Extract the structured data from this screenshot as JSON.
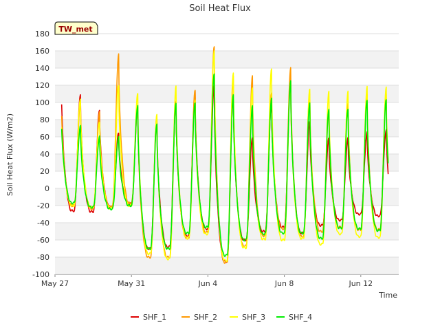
{
  "chart_data": {
    "type": "line",
    "title": "Soil Heat Flux",
    "xlabel": "Time",
    "ylabel": "Soil Heat Flux (W/m2)",
    "badge": "TW_met",
    "ylim": [
      -100,
      180
    ],
    "yticks": [
      -100,
      -80,
      -60,
      -40,
      -20,
      0,
      20,
      40,
      60,
      80,
      100,
      120,
      140,
      160,
      180
    ],
    "xlim": [
      "2024-05-27",
      "2024-06-15"
    ],
    "xticks": [
      {
        "label": "May 27",
        "day": 0
      },
      {
        "label": "May 31",
        "day": 4
      },
      {
        "label": "Jun 4",
        "day": 8
      },
      {
        "label": "Jun 8",
        "day": 12
      },
      {
        "label": "Jun 12",
        "day": 16
      }
    ],
    "grid": "horizontal bands",
    "legend": "bottom",
    "series": [
      {
        "name": "SHF_1",
        "color": "#dd0000",
        "min": [
          -26,
          -26,
          -27,
          -22,
          -18,
          -70,
          -68,
          -55,
          -47,
          -85,
          -60,
          -50,
          -45,
          -52,
          -43,
          -37,
          -30,
          -32,
          -30,
          -42
        ],
        "max": [
          130,
          110,
          92,
          65,
          95,
          80,
          100,
          112,
          120,
          110,
          60,
          100,
          125,
          78,
          58,
          58,
          65,
          68
        ]
      },
      {
        "name": "SHF_2",
        "color": "#ff9900",
        "min": [
          -22,
          -20,
          -24,
          -21,
          -17,
          -80,
          -80,
          -57,
          -51,
          -86,
          -67,
          -55,
          -47,
          -56,
          -50,
          -45,
          -48,
          -48,
          -45,
          -45
        ],
        "max": [
          112,
          100,
          88,
          156,
          95,
          85,
          100,
          115,
          165,
          130,
          130,
          110,
          140,
          110,
          90,
          100,
          110,
          110
        ]
      },
      {
        "name": "SHF_3",
        "color": "#ffff00",
        "min": [
          -20,
          -20,
          -22,
          -23,
          -20,
          -76,
          -82,
          -58,
          -53,
          -84,
          -69,
          -59,
          -60,
          -58,
          -65,
          -53,
          -56,
          -57,
          -48,
          -45
        ],
        "max": [
          95,
          105,
          78,
          120,
          110,
          85,
          118,
          102,
          160,
          135,
          118,
          140,
          125,
          115,
          112,
          112,
          118,
          118
        ]
      },
      {
        "name": "SHF_4",
        "color": "#00ee00",
        "min": [
          -13,
          -17,
          -22,
          -24,
          -20,
          -70,
          -70,
          -52,
          -45,
          -78,
          -60,
          -53,
          -52,
          -52,
          -58,
          -46,
          -47,
          -49,
          -42,
          -42
        ],
        "max": [
          92,
          72,
          60,
          60,
          97,
          76,
          100,
          100,
          133,
          108,
          95,
          104,
          125,
          100,
          93,
          93,
          103,
          103
        ]
      }
    ]
  }
}
